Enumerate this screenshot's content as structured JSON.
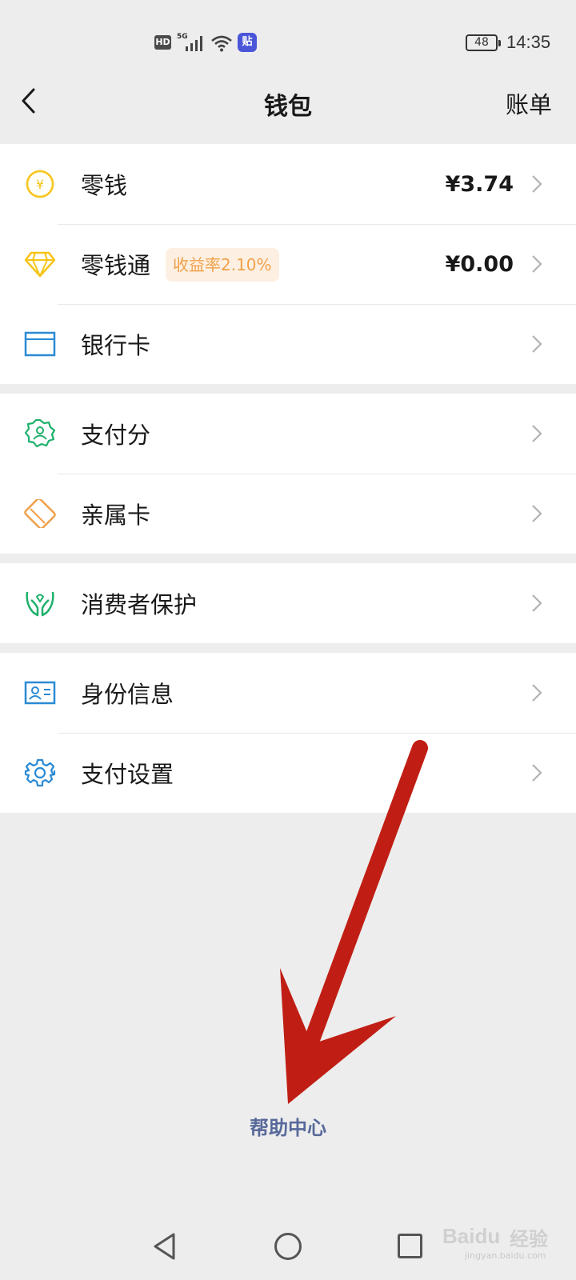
{
  "status_bar": {
    "hd": "HD",
    "network": "5G",
    "app_badge": "贴",
    "battery": "48",
    "time": "14:35"
  },
  "header": {
    "title": "钱包",
    "right_link": "账单"
  },
  "groups": [
    {
      "items": [
        {
          "label": "零钱",
          "value": "¥3.74",
          "icon": "yuan-coin-icon"
        },
        {
          "label": "零钱通",
          "badge": "收益率2.10%",
          "value": "¥0.00",
          "icon": "diamond-icon"
        },
        {
          "label": "银行卡",
          "icon": "bank-card-icon"
        }
      ]
    },
    {
      "items": [
        {
          "label": "支付分",
          "icon": "pay-score-icon"
        },
        {
          "label": "亲属卡",
          "icon": "family-card-icon"
        }
      ]
    },
    {
      "items": [
        {
          "label": "消费者保护",
          "icon": "protect-hands-icon"
        }
      ]
    },
    {
      "items": [
        {
          "label": "身份信息",
          "icon": "id-card-icon"
        },
        {
          "label": "支付设置",
          "icon": "gear-icon"
        }
      ]
    }
  ],
  "footer": {
    "help_center": "帮助中心"
  },
  "colors": {
    "background": "#ededed",
    "card": "#ffffff",
    "link": "#57699a",
    "badge_text": "#f0a04a",
    "badge_bg": "#fdf0e2",
    "annotation_arrow": "#c01e14"
  },
  "watermark": {
    "brand": "Baidu",
    "cn": "经验",
    "url": "jingyan.baidu.com"
  }
}
